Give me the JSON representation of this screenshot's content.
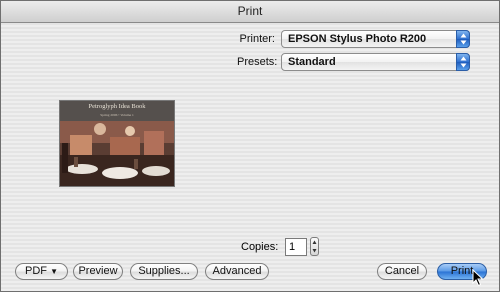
{
  "window": {
    "title": "Print"
  },
  "printer": {
    "label": "Printer:",
    "value": "EPSON Stylus Photo R200"
  },
  "presets": {
    "label": "Presets:",
    "value": "Standard"
  },
  "preview": {
    "book_title": "Petroglyph Idea Book",
    "book_subtitle": "Spring 2006 • Volume 1"
  },
  "copies": {
    "label": "Copies:",
    "value": "1"
  },
  "buttons": {
    "pdf": "PDF",
    "preview": "Preview",
    "supplies": "Supplies...",
    "advanced": "Advanced",
    "cancel": "Cancel",
    "print": "Print"
  },
  "colors": {
    "accent": "#2a72d4"
  }
}
